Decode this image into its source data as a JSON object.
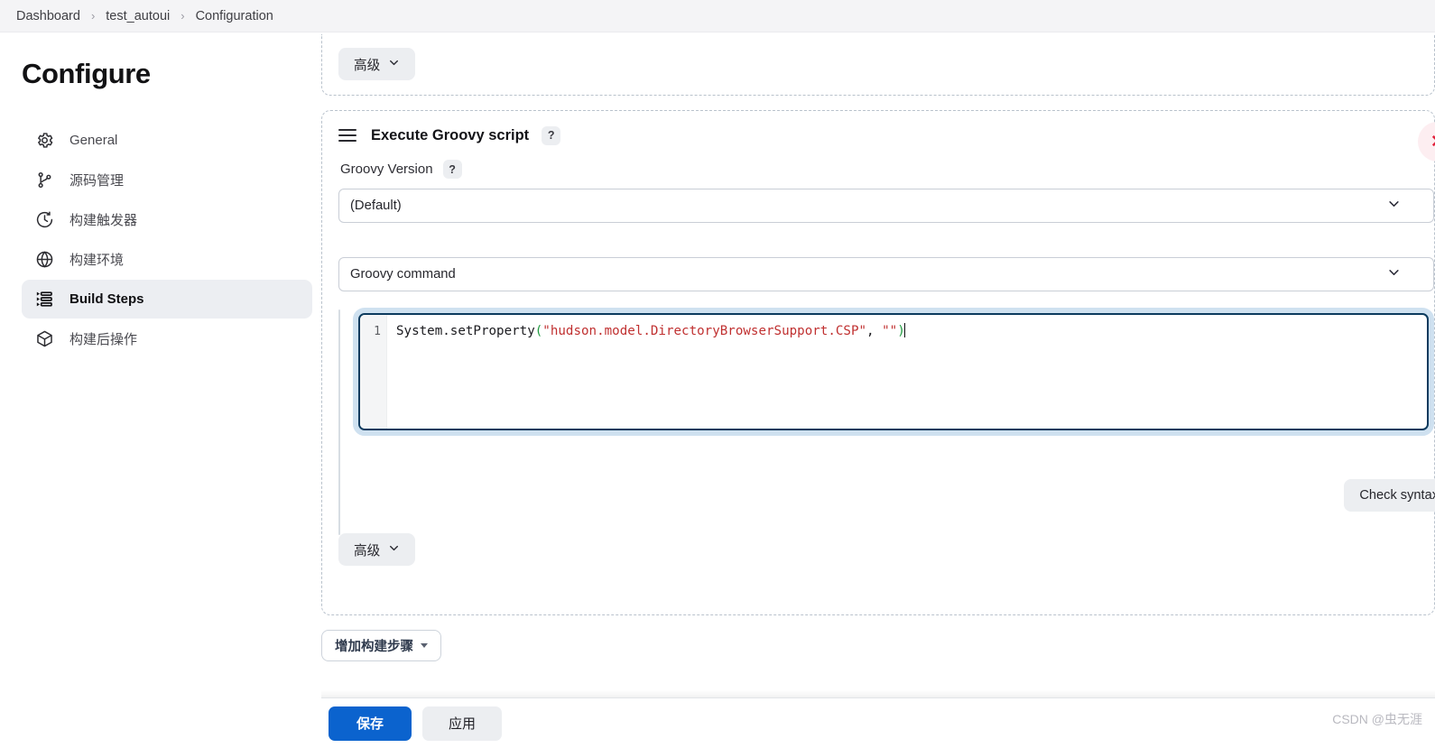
{
  "breadcrumb": {
    "items": [
      {
        "label": "Dashboard"
      },
      {
        "label": "test_autoui"
      },
      {
        "label": "Configuration"
      }
    ],
    "separator": "›"
  },
  "sidebar": {
    "title": "Configure",
    "items": [
      {
        "label": "General",
        "icon": "gear-icon",
        "active": false
      },
      {
        "label": "源码管理",
        "icon": "git-branch-icon",
        "active": false
      },
      {
        "label": "构建触发器",
        "icon": "clock-icon",
        "active": false
      },
      {
        "label": "构建环境",
        "icon": "globe-icon",
        "active": false
      },
      {
        "label": "Build Steps",
        "icon": "list-steps-icon",
        "active": true
      },
      {
        "label": "构建后操作",
        "icon": "package-icon",
        "active": false
      }
    ]
  },
  "main": {
    "previous_panel": {
      "advanced_label": "高级",
      "chevron": "chevron-down-icon"
    },
    "groovy_panel": {
      "drag_handle": "drag-handle-icon",
      "title": "Execute Groovy script",
      "help": "?",
      "delete_icon": "✕",
      "version_label": "Groovy Version",
      "version_help": "?",
      "version_value": "(Default)",
      "command_value": "Groovy command",
      "editor": {
        "line_number": "1",
        "code_prefix": "System.setProperty",
        "open_paren": "(",
        "string_one": "\"hudson.model.DirectoryBrowserSupport.CSP\"",
        "comma": ", ",
        "string_two": "\"\"",
        "close_paren": ")"
      },
      "check_syntax_label": "Check syntax",
      "advanced_label": "高级"
    },
    "add_build_step_label": "增加构建步骤"
  },
  "action_bar": {
    "save_label": "保存",
    "apply_label": "应用"
  },
  "watermark": "CSDN @虫无涯",
  "colors": {
    "accent_blue": "#0b63ce",
    "editor_border": "#0c3b5e",
    "editor_focus_ring": "#cfe1f0",
    "danger_red": "#e2223c",
    "string_red": "#c03030",
    "paren_green": "#1f9a3f",
    "panel_dashed": "#b9c2cc",
    "sidebar_active_bg": "#eceef2"
  }
}
